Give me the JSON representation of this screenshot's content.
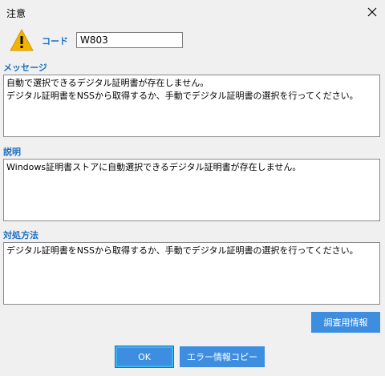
{
  "window": {
    "title": "注意"
  },
  "code": {
    "label": "コード",
    "value": "W803"
  },
  "message": {
    "label": "メッセージ",
    "text": "自動で選択できるデジタル証明書が存在しません。\nデジタル証明書をNSSから取得するか、手動でデジタル証明書の選択を行ってください。"
  },
  "description": {
    "label": "説明",
    "text": "Windows証明書ストアに自動選択できるデジタル証明書が存在しません。"
  },
  "remedy": {
    "label": "対処方法",
    "text": "デジタル証明書をNSSから取得するか、手動でデジタル証明書の選択を行ってください。"
  },
  "buttons": {
    "debug_info": "調査用情報",
    "ok": "OK",
    "copy_error": "エラー情報コピー"
  },
  "colors": {
    "accent": "#1a6fc4",
    "button": "#3d8ee0",
    "warning": "#f2b400"
  }
}
